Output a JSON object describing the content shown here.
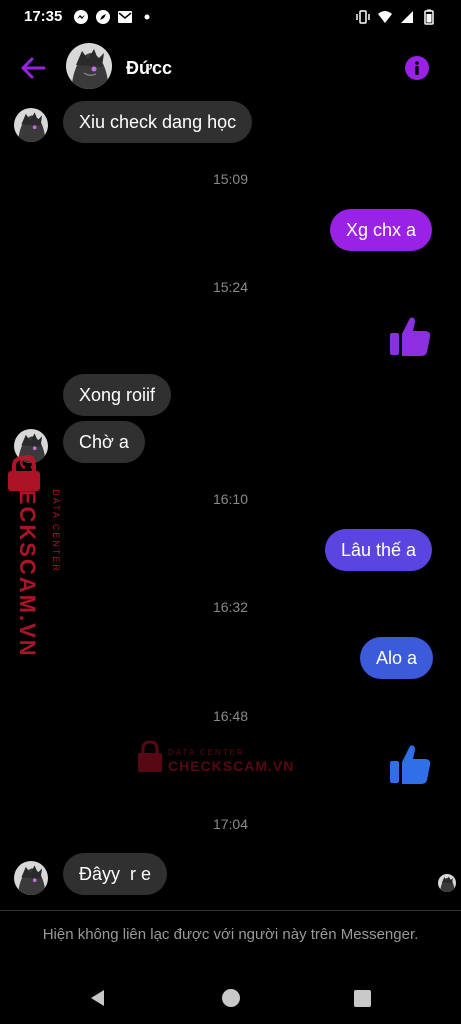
{
  "status_bar": {
    "time": "17:35"
  },
  "header": {
    "contact_name": "Đứcc"
  },
  "messages": [
    {
      "text": "Xiu check dang học"
    },
    {
      "text": "Xg chx a"
    },
    {
      "text": "Xong roiif"
    },
    {
      "text": "Chờ a"
    },
    {
      "text": "Lâu thế a"
    },
    {
      "text": "Alo a"
    },
    {
      "text": "Đâyy  r e"
    }
  ],
  "timestamps": [
    "15:09",
    "15:24",
    "16:10",
    "16:32",
    "16:48",
    "17:04"
  ],
  "watermark": {
    "brand": "CHECKSCAM.VN",
    "sub": "DATA CENTER"
  },
  "notice": "Hiện không liên lạc được với người này trên Messenger.",
  "colors": {
    "purple": "#9a22e6",
    "violet": "#7c3aed",
    "blue": "#3b5bdb",
    "incoming_bubble": "#303030",
    "watermark_red": "#c0162b"
  }
}
